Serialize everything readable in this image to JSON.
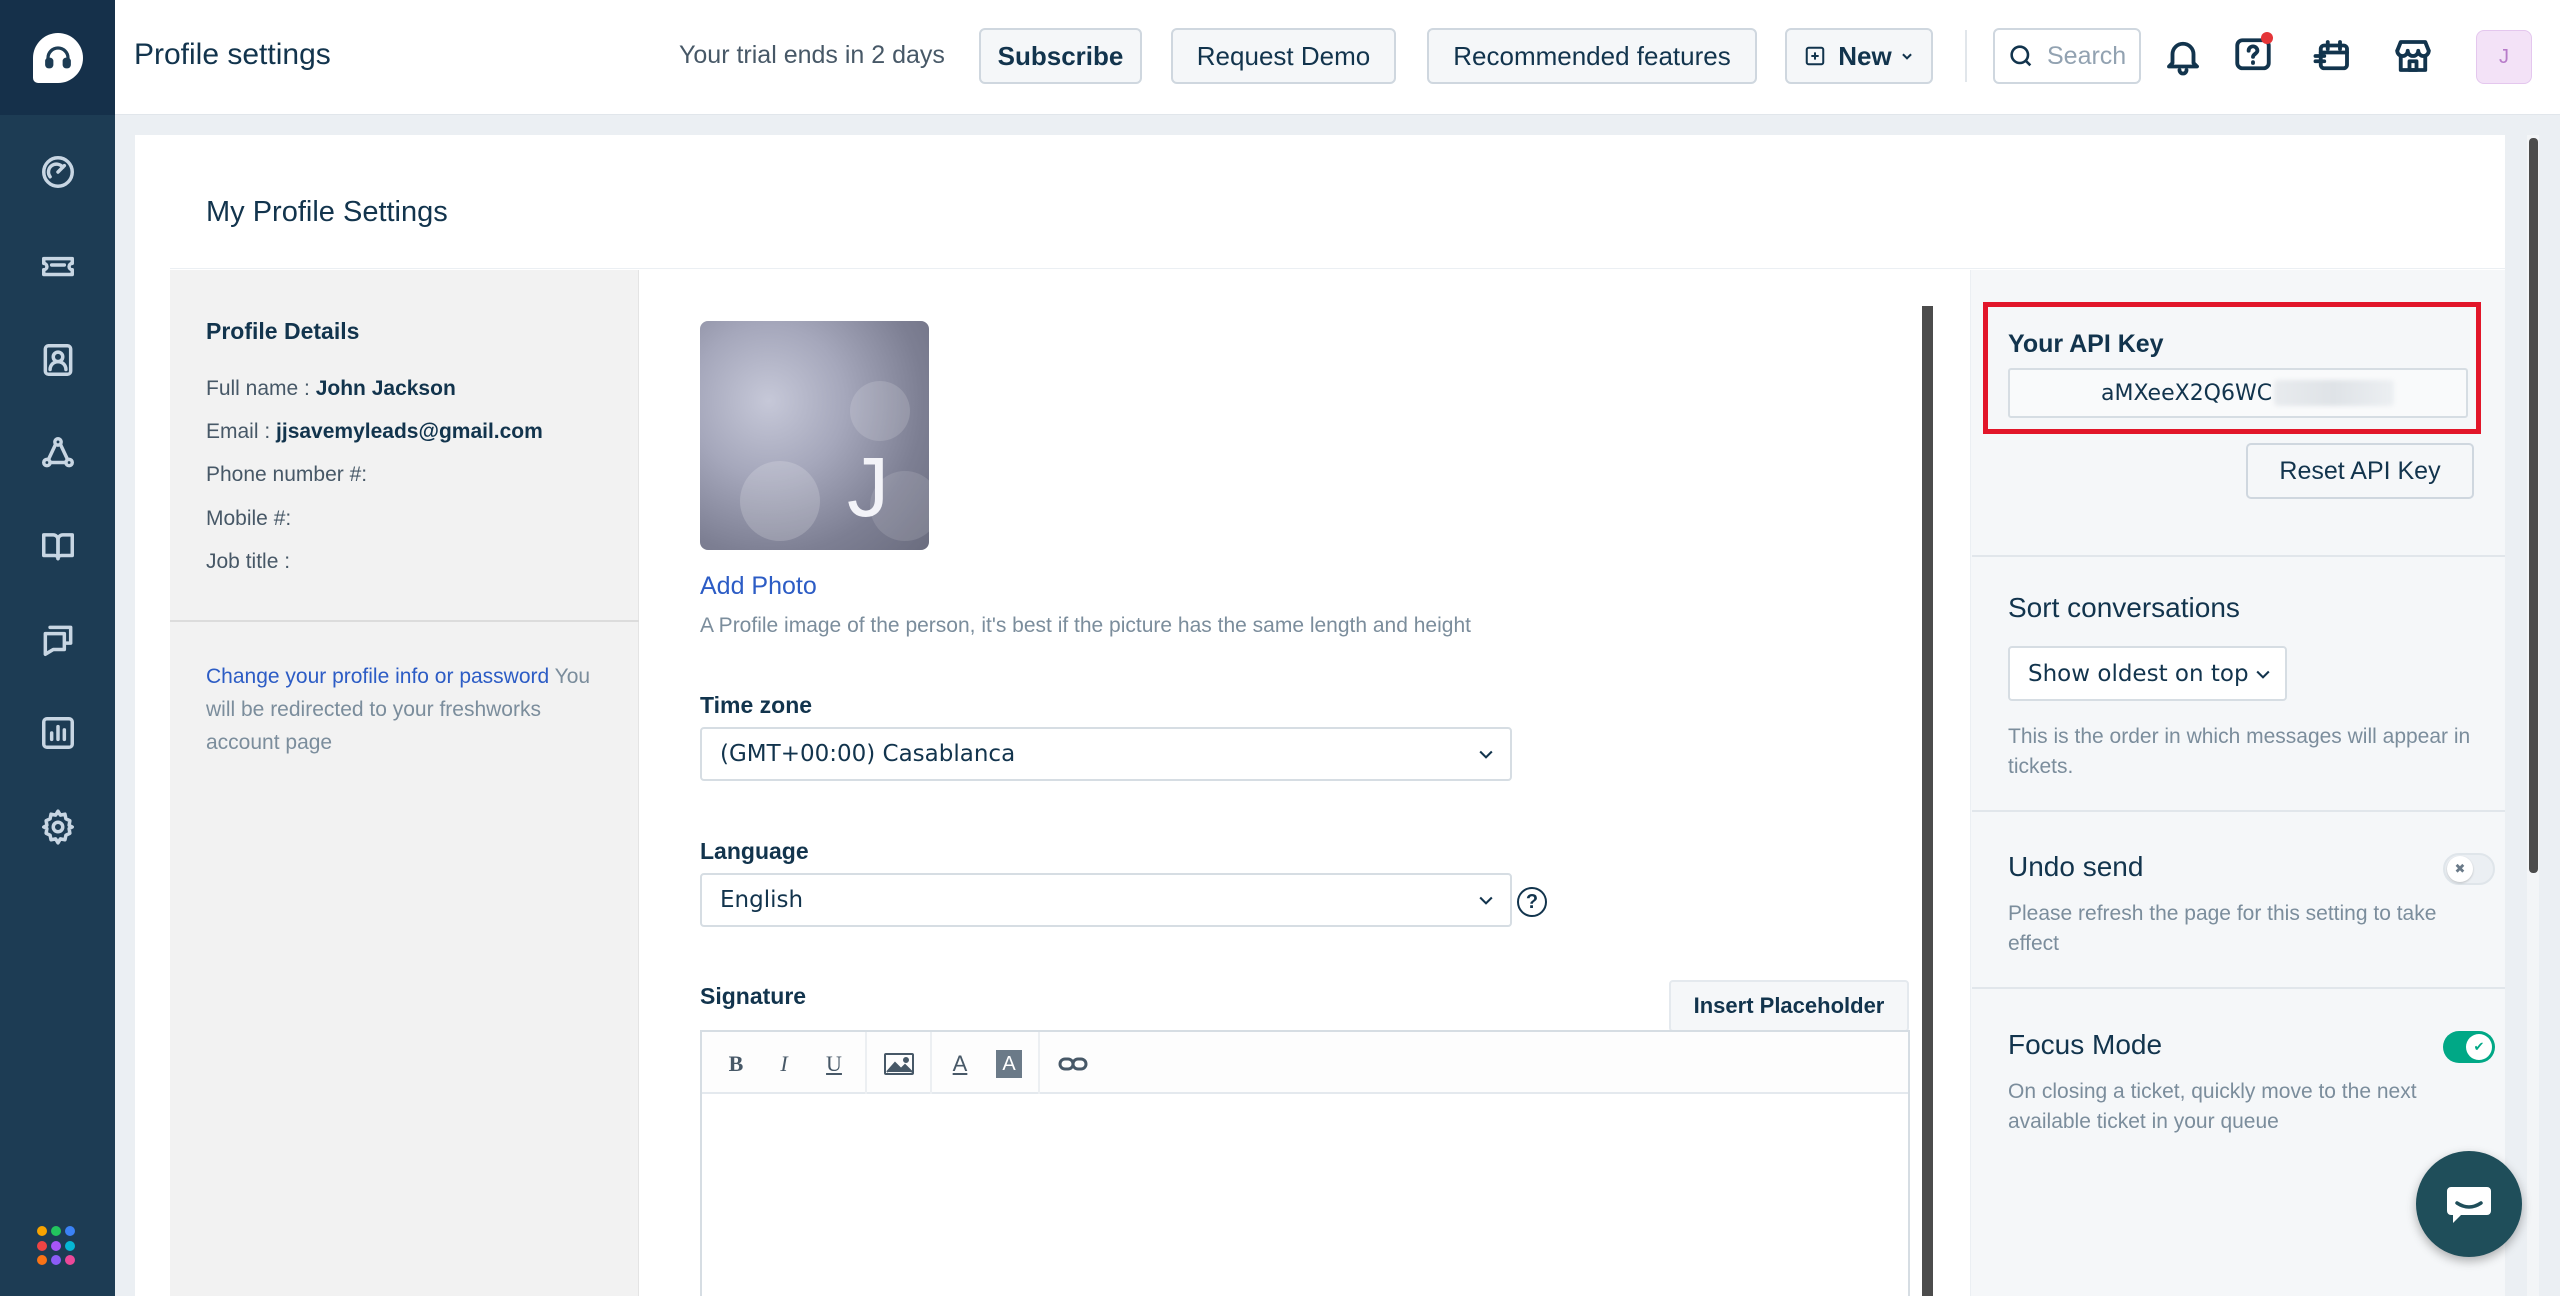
{
  "header": {
    "page_title": "Profile settings",
    "trial_text": "Your trial ends in 2 days",
    "subscribe_label": "Subscribe",
    "request_demo_label": "Request Demo",
    "recommended_label": "Recommended features",
    "new_label": "New",
    "search_placeholder": "Search",
    "avatar_initial": "J"
  },
  "sidebar": {
    "items": [
      {
        "icon": "dashboard-icon"
      },
      {
        "icon": "tickets-icon"
      },
      {
        "icon": "contacts-icon"
      },
      {
        "icon": "groups-icon"
      },
      {
        "icon": "knowledge-base-icon"
      },
      {
        "icon": "conversations-icon"
      },
      {
        "icon": "reports-icon"
      },
      {
        "icon": "settings-icon"
      }
    ],
    "apps_colors": [
      "#f7a300",
      "#22c55e",
      "#3b82f6",
      "#ef4444",
      "#a855f7",
      "#06b6d4",
      "#f97316",
      "#8b5cf6",
      "#ec4899"
    ]
  },
  "main": {
    "title": "My Profile Settings",
    "profile": {
      "section_title": "Profile Details",
      "full_name_label": "Full name :",
      "full_name": "John Jackson",
      "email_label": "Email :",
      "email": "jjsavemyleads@gmail.com",
      "phone_label": "Phone number #:",
      "mobile_label": "Mobile #:",
      "job_title_label": "Job title :",
      "help_link": "Change your profile info or password",
      "help_text": " You will be redirected to your freshworks account page"
    },
    "photo": {
      "initial": "J",
      "add_photo": "Add Photo",
      "help": "A Profile image of the person, it's best if the picture has the same length and height"
    },
    "timezone": {
      "label": "Time zone",
      "value": "(GMT+00:00) Casablanca"
    },
    "language": {
      "label": "Language",
      "value": "English"
    },
    "signature": {
      "label": "Signature",
      "insert_placeholder": "Insert Placeholder",
      "toolbar": {
        "bold": "B",
        "italic": "I",
        "underline": "U",
        "font_color": "A",
        "bg_color": "A"
      }
    }
  },
  "right_panel": {
    "api_key_label": "Your API Key",
    "api_key_visible": "aMXeeX2Q6WC",
    "reset_label": "Reset API Key",
    "sort": {
      "title": "Sort conversations",
      "value": "Show oldest on top",
      "help": "This is the order in which messages will appear in tickets."
    },
    "undo_send": {
      "title": "Undo send",
      "help": "Please refresh the page for this setting to take effect",
      "enabled": false
    },
    "focus_mode": {
      "title": "Focus Mode",
      "help": "On closing a ticket, quickly move to the next available ticket in your queue",
      "enabled": true
    }
  },
  "colors": {
    "sidebar": "#1d3c54",
    "highlight": "#e2162a",
    "link": "#2c5cc5",
    "toggle_on": "#00a886"
  }
}
